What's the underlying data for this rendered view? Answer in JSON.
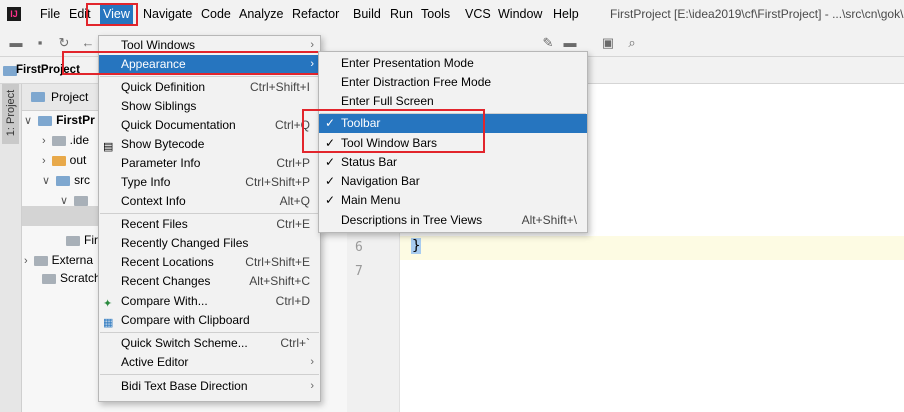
{
  "menubar": {
    "items": [
      {
        "label": "File"
      },
      {
        "label": "Edit"
      },
      {
        "label": "View"
      },
      {
        "label": "Navigate"
      },
      {
        "label": "Code"
      },
      {
        "label": "Analyze"
      },
      {
        "label": "Refactor"
      },
      {
        "label": "Build"
      },
      {
        "label": "Run"
      },
      {
        "label": "Tools"
      },
      {
        "label": "VCS"
      },
      {
        "label": "Window"
      },
      {
        "label": "Help"
      }
    ],
    "window_title": "FirstProject [E:\\idea2019\\cf\\FirstProject] - ...\\src\\cn\\gok\\"
  },
  "navbar": {
    "project": "FirstProject"
  },
  "sidebar": {
    "tab_label": "1: Project"
  },
  "project_panel": {
    "header": "Project",
    "tree": [
      {
        "label": "FirstPr"
      },
      {
        "label": ".ide"
      },
      {
        "label": "out"
      },
      {
        "label": "src"
      },
      {
        "label": ""
      },
      {
        "label": "Firs"
      },
      {
        "label": "Externa"
      },
      {
        "label": "Scratch"
      }
    ]
  },
  "editor": {
    "line_numbers": [
      "6",
      "7"
    ],
    "code_line6": "}"
  },
  "view_menu": {
    "items": [
      {
        "label": "Tool Windows",
        "shortcut": ""
      },
      {
        "label": "Appearance",
        "shortcut": ""
      },
      {
        "label": "Quick Definition",
        "shortcut": "Ctrl+Shift+I"
      },
      {
        "label": "Show Siblings",
        "shortcut": ""
      },
      {
        "label": "Quick Documentation",
        "shortcut": "Ctrl+Q"
      },
      {
        "label": "Show Bytecode",
        "shortcut": ""
      },
      {
        "label": "Parameter Info",
        "shortcut": "Ctrl+P"
      },
      {
        "label": "Type Info",
        "shortcut": "Ctrl+Shift+P"
      },
      {
        "label": "Context Info",
        "shortcut": "Alt+Q"
      },
      {
        "label": "Recent Files",
        "shortcut": "Ctrl+E"
      },
      {
        "label": "Recently Changed Files",
        "shortcut": ""
      },
      {
        "label": "Recent Locations",
        "shortcut": "Ctrl+Shift+E"
      },
      {
        "label": "Recent Changes",
        "shortcut": "Alt+Shift+C"
      },
      {
        "label": "Compare With...",
        "shortcut": "Ctrl+D"
      },
      {
        "label": "Compare with Clipboard",
        "shortcut": ""
      },
      {
        "label": "Quick Switch Scheme...",
        "shortcut": "Ctrl+`"
      },
      {
        "label": "Active Editor",
        "shortcut": ""
      },
      {
        "label": "Bidi Text Base Direction",
        "shortcut": ""
      }
    ]
  },
  "appearance_menu": {
    "items": [
      {
        "label": "Enter Presentation Mode",
        "shortcut": "",
        "checked": false
      },
      {
        "label": "Enter Distraction Free Mode",
        "shortcut": "",
        "checked": false
      },
      {
        "label": "Enter Full Screen",
        "shortcut": "",
        "checked": false
      },
      {
        "label": "Toolbar",
        "shortcut": "",
        "checked": true
      },
      {
        "label": "Tool Window Bars",
        "shortcut": "",
        "checked": true
      },
      {
        "label": "Status Bar",
        "shortcut": "",
        "checked": true
      },
      {
        "label": "Navigation Bar",
        "shortcut": "",
        "checked": true
      },
      {
        "label": "Main Menu",
        "shortcut": "",
        "checked": true
      },
      {
        "label": "Descriptions in Tree Views",
        "shortcut": "Alt+Shift+\\",
        "checked": false
      }
    ],
    "check_glyph": "✓"
  },
  "colors": {
    "highlight": "#2675bf",
    "annotation": "#e2252c",
    "menu_bg": "#f2f2f2"
  }
}
